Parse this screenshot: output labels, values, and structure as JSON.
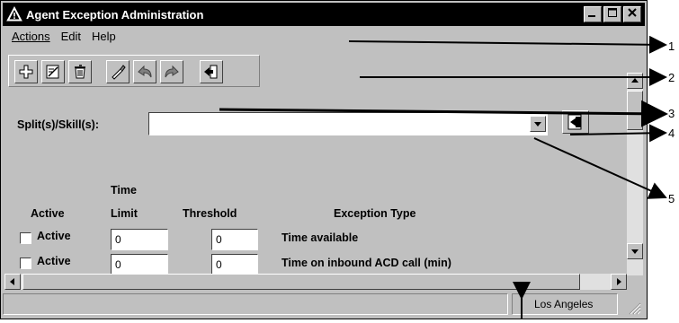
{
  "window": {
    "title": "Agent Exception Administration"
  },
  "menu": [
    {
      "label": "Actions"
    },
    {
      "label": "Edit"
    },
    {
      "label": "Help"
    }
  ],
  "toolbar": {
    "icons": [
      "add-icon",
      "edit-icon",
      "delete-icon",
      "clear-icon",
      "undo-icon",
      "redo-icon",
      "exit-icon"
    ]
  },
  "form": {
    "split_label": "Split(s)/Skill(s):",
    "split_value": "",
    "headers": {
      "active": "Active",
      "time_limit_line1": "Time",
      "time_limit_line2": "Limit",
      "threshold": "Threshold",
      "exception_type": "Exception Type"
    },
    "rows": [
      {
        "active_label": "Active",
        "time_limit": "0",
        "threshold": "0",
        "exception_type": "Time available",
        "checked": false
      },
      {
        "active_label": "Active",
        "time_limit": "0",
        "threshold": "0",
        "exception_type": "Time on inbound ACD call (min)",
        "checked": false
      }
    ]
  },
  "status": {
    "location": "Los Angeles"
  },
  "callouts": [
    "1",
    "2",
    "3",
    "4",
    "5"
  ]
}
